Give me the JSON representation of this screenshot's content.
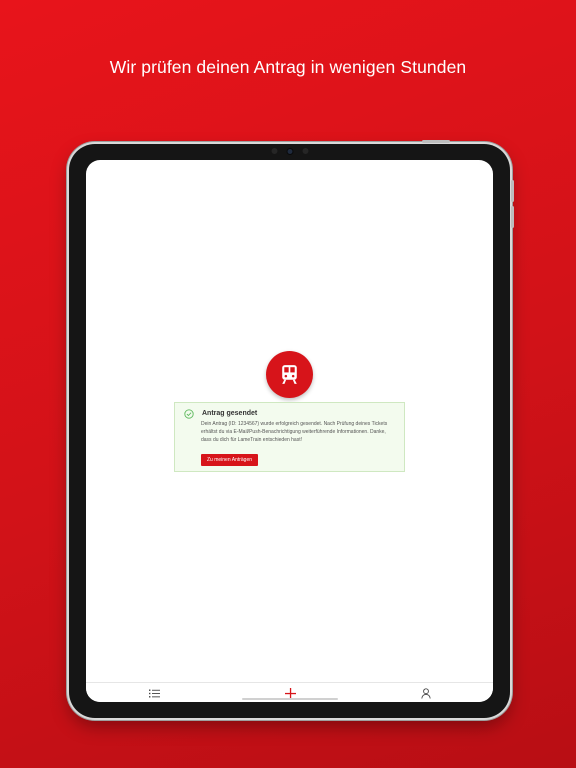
{
  "headline": "Wir prüfen deinen Antrag in wenigen Stunden",
  "colors": {
    "brand_red": "#d7141a",
    "success_bg": "#f3fbee",
    "success_green": "#5cb85c"
  },
  "alert": {
    "icon": "check-circle-icon",
    "title": "Antrag gesendet",
    "body": "Dein Antrag (ID: 1234567) wurde erfolgreich gesendet. Nach Prüfung deines Tickets erhältst du via E-Mail/Push-Benachrichtigung weiterführende Informationen. Danke, dass du dich für LameTrain entschieden hast!",
    "button_label": "Zu meinen Anträgen"
  },
  "logo_icon": "train-icon",
  "tabbar": {
    "items": [
      {
        "icon": "list-icon",
        "active": false
      },
      {
        "icon": "plus-icon",
        "active": true
      },
      {
        "icon": "user-icon",
        "active": false
      }
    ]
  }
}
